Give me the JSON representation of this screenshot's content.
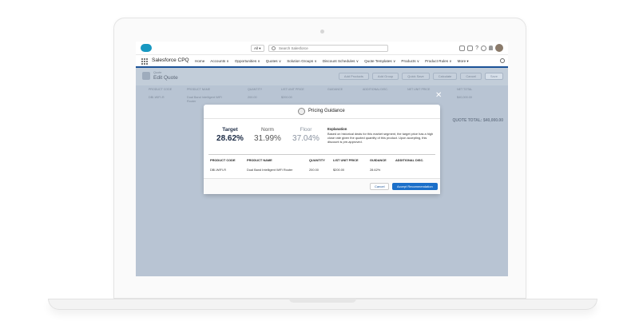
{
  "header": {
    "scope": "All ▾",
    "search_placeholder": "Search Salesforce",
    "help": "?"
  },
  "nav": {
    "app_name": "Salesforce CPQ",
    "items": [
      "Home",
      "Accounts ∨",
      "Opportunities ∨",
      "Quotes ∨",
      "Solution Groups ∨",
      "Discount Schedules ∨",
      "Quote Templates ∨",
      "Products ∨",
      "Product Rules ∨",
      "More ▾"
    ]
  },
  "page": {
    "subtitle": "Quote",
    "title": "Edit Quote",
    "buttons": [
      "Add Products",
      "Add Group",
      "Quick Save",
      "Calculate",
      "Cancel",
      "Save"
    ],
    "grid_headers": [
      "PRODUCT CODE",
      "PRODUCT NAME",
      "QUANTITY",
      "LIST UNIT PRICE",
      "GUIDANCE",
      "ADDITIONAL DISC.",
      "NET UNIT PRICE",
      "NET TOTAL"
    ],
    "row": {
      "code": "DBI-WIFI-R",
      "name": "Dual Band Intelligent WiFi Router",
      "qty": "200.00",
      "list_price": "$200.00",
      "net_total": "$40,000.00"
    },
    "total": "QUOTE TOTAL: $40,000.00"
  },
  "modal": {
    "title": "Pricing Guidance",
    "close": "✕",
    "metrics": [
      {
        "label": "Target",
        "value": "28.62%"
      },
      {
        "label": "Norm",
        "value": "31.99%"
      },
      {
        "label": "Floor",
        "value": "37.04%"
      }
    ],
    "explanation_label": "Explanation",
    "explanation_text": "Based on historical deals for this market segment, the target price has a high close rate given the quoted quantity of this product. Upon accepting, this discount is pre-approved.",
    "table_headers": [
      "PRODUCT CODE",
      "PRODUCT NAME",
      "QUANTITY",
      "LIST UNIT PRICE",
      "GUIDANCE",
      "ADDITIONAL DISC."
    ],
    "table_row": [
      "DBI-WIFI-R",
      "Dual Band Intelligent WiFi Router",
      "200.00",
      "$200.00",
      "28.62%",
      ""
    ],
    "cancel_label": "Cancel",
    "accept_label": "Accept Recommendation"
  }
}
